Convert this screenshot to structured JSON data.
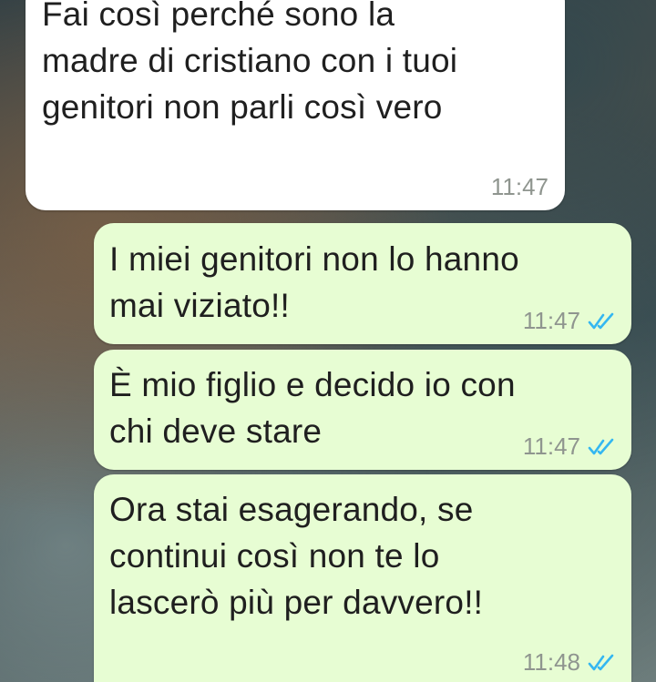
{
  "messages": [
    {
      "direction": "incoming",
      "text": "Fai così perché sono la\nmadre di cristiano con i tuoi\ngenitori non parli così vero",
      "time": "11:47"
    },
    {
      "direction": "outgoing",
      "text": "I miei genitori non lo hanno\nmai viziato!!",
      "time": "11:47",
      "status": "read"
    },
    {
      "direction": "outgoing",
      "text": "È mio figlio e decido io con\nchi deve stare",
      "time": "11:47",
      "status": "read"
    },
    {
      "direction": "outgoing",
      "text": "Ora stai esagerando, se\ncontinui così non te lo\nlascerò più per davvero!!",
      "time": "11:48",
      "status": "read"
    }
  ],
  "colors": {
    "incoming_bubble": "#ffffff",
    "outgoing_bubble": "#e7fdd3",
    "read_ticks": "#34b7f1",
    "timestamp": "#8f958f"
  },
  "icons": {
    "read_status": "double-check-icon"
  }
}
